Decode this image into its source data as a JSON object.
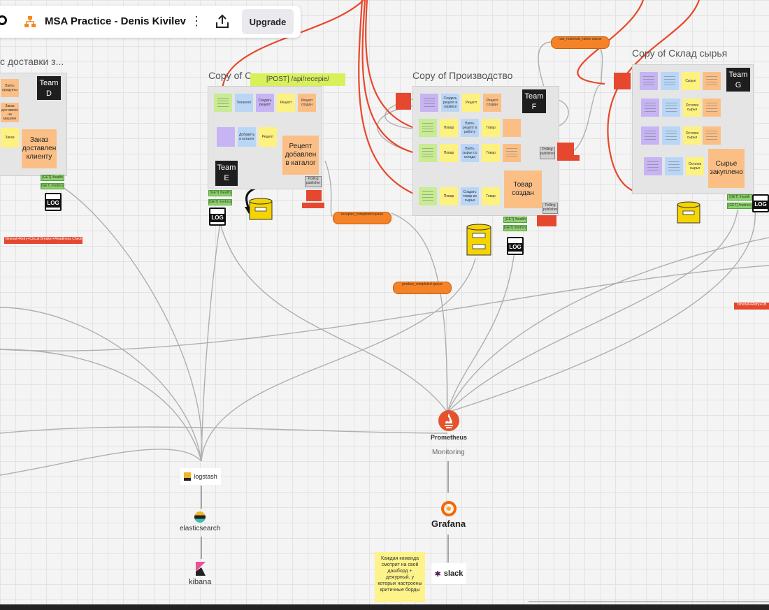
{
  "header": {
    "board_title": "MSA Practice - Denis Kivilev",
    "upgrade_label": "Upgrade"
  },
  "frames": {
    "delivery": {
      "title": "с доставки з...",
      "team": "Team D",
      "big_note": "Заказ доставлен клиенту",
      "small_notes": [
        "Взять продукты",
        "Заказ доставлен на машине",
        "Заказ"
      ]
    },
    "recipes": {
      "title": "Copy of Сервис рецеп...",
      "team": "Team E",
      "endpoint": "[POST] /api/recepie/",
      "big_note": "Рецепт добавлен в каталог",
      "notes": [
        "Технолог",
        "Создать рецепт",
        "Рецепт",
        "Рецепт создан",
        "Добавить в каталог",
        "Рецепт"
      ]
    },
    "production": {
      "title": "Copy of Производство",
      "team": "Team F",
      "big_note": "Товар создан",
      "notes": [
        "Создать рецепт в сервисе",
        "Рецепт",
        "Рецепт создан",
        "Повар",
        "Взять рецепт в работу",
        "Товар",
        "Повар",
        "Взять сырье со склада",
        "Товар",
        "Повар",
        "Создать товар из сырья",
        "Товар"
      ]
    },
    "warehouse": {
      "title": "Copy of Склад сырья",
      "team": "Team G",
      "big_note": "Сырье закуплено",
      "notes": [
        "Сырье",
        "Остатки сырья",
        "Остатки сырья",
        "Остатки сырья"
      ]
    }
  },
  "queues": {
    "raw_materials": "raw_materials_taken queue",
    "recepies_completed": "recepies_completed queue",
    "products_completed": "product_completed queue"
  },
  "tags": {
    "get_health": "[GET] /health",
    "get_metrics": "[GET] /metrics",
    "log": "LOG",
    "rabbit": "Polling publisher",
    "error_delivery": "Timeout+Retry+Circuit Breaker+Readiness Check",
    "error_right": "Timeout+Retry+CB"
  },
  "monitoring": {
    "prometheus": "Prometheus",
    "monitoring_label": "Monitoring",
    "grafana": "Grafana",
    "slack": "slack",
    "note": "Каждая команда смотрит на свой дашборд + дежурный, у которых настроены критичные борды"
  },
  "logging": {
    "logstash": "logstash",
    "elasticsearch": "elasticsearch",
    "kibana": "kibana"
  },
  "colors": {
    "accent_red": "#e5482f",
    "queue_orange": "#f58226",
    "prometheus_orange": "#e6522c"
  }
}
